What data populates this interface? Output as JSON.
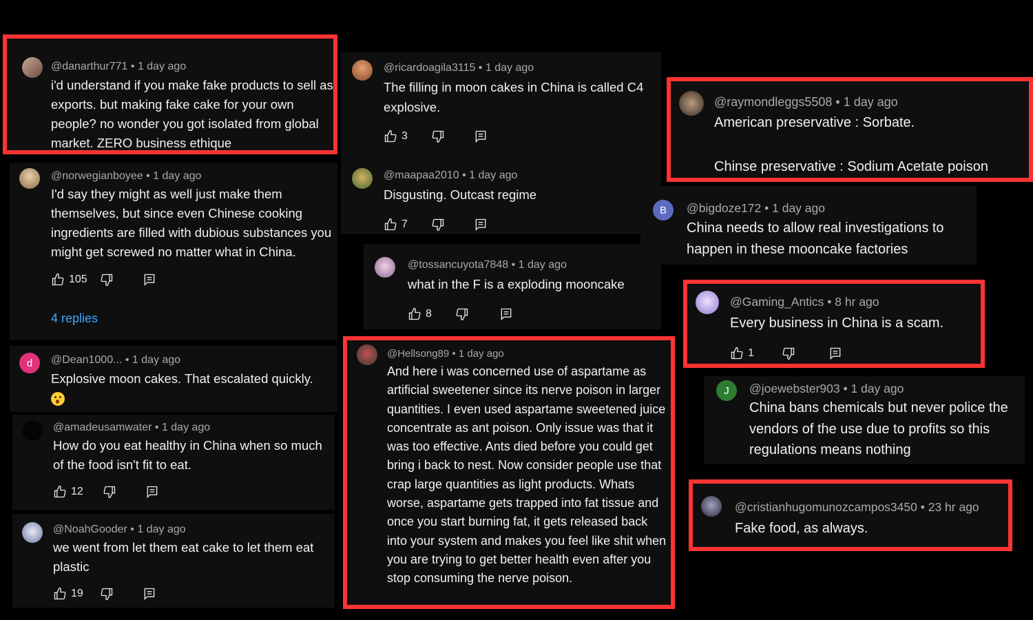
{
  "comments": [
    {
      "handle": "@danarthur771",
      "time": "1 day ago",
      "text": "i'd understand if you make fake products to sell as exports. but making fake cake for your own people? no wonder you got isolated from global market. ZERO business ethique"
    },
    {
      "handle": "@norwegianboyee",
      "time": "1 day ago",
      "text": "I'd say they might as well just make them themselves, but since even Chinese cooking ingredients are filled with dubious substances you might get screwed no matter what in China.",
      "likes": "105",
      "replies": "4 replies"
    },
    {
      "handle": "@Dean1000...",
      "time": "1 day ago",
      "text": "Explosive  moon cakes.  That escalated  quickly.",
      "avatar_letter": "d"
    },
    {
      "handle": "@amadeusamwater",
      "time": "1 day ago",
      "text": "How do you eat healthy in China when so much of the food isn't fit to eat.",
      "likes": "12"
    },
    {
      "handle": "@NoahGooder",
      "time": "1 day ago",
      "text": "we went from let them eat cake to let them eat plastic",
      "likes": "19"
    },
    {
      "handle": "@ricardoagila3115",
      "time": "1 day ago",
      "text": "The filling in moon cakes in China is called C4 explosive.",
      "likes": "3"
    },
    {
      "handle": "@maapaa2010",
      "time": "1 day ago",
      "text": "Disgusting. Outcast regime",
      "likes": "7"
    },
    {
      "handle": "@tossancuyota7848",
      "time": "1 day ago",
      "text": "what in the F is a exploding mooncake",
      "likes": "8"
    },
    {
      "handle": "@Hellsong89",
      "time": "1 day ago",
      "text": "And here i was concerned use of aspartame as artificial sweetener since its nerve poison in larger quantities. I even used aspartame sweetened juice concentrate as ant poison. Only issue was that it was too effective. Ants died before you could get bring i back to nest. Now consider people use that crap large quantities as light products. Whats worse, aspartame gets trapped into fat tissue and once you start burning fat, it gets released back into your system and makes you feel like shit when you are trying to get better health even after you stop consuming the nerve poison."
    },
    {
      "handle": "@raymondleggs5508",
      "time": "1 day ago",
      "text_line1": "American preservative : Sorbate.",
      "text_line2": "Chinse preservative : Sodium Acetate poison"
    },
    {
      "handle": "@bigdoze172",
      "time": "1 day ago",
      "text": "China needs to allow real investigations to happen in these mooncake factories",
      "avatar_letter": "B"
    },
    {
      "handle": "@Gaming_Antics",
      "time": "8 hr ago",
      "text": "Every business in China is a scam.",
      "likes": "1"
    },
    {
      "handle": "@joewebster903",
      "time": "1 day ago",
      "text": "China bans chemicals but never police the vendors of the use due to profits so this regulations means nothing",
      "avatar_letter": "J"
    },
    {
      "handle": "@cristianhugomunozcampos3450",
      "time": "23 hr ago",
      "text": "Fake food, as always."
    }
  ],
  "separator": " • ",
  "icons": {
    "like": "thumbs-up-icon",
    "dislike": "thumbs-down-icon",
    "reply": "reply-icon"
  },
  "colors": {
    "highlight": "#ff3333",
    "link": "#3ea6ff",
    "card": "#0f0f0f",
    "background": "#000000"
  }
}
